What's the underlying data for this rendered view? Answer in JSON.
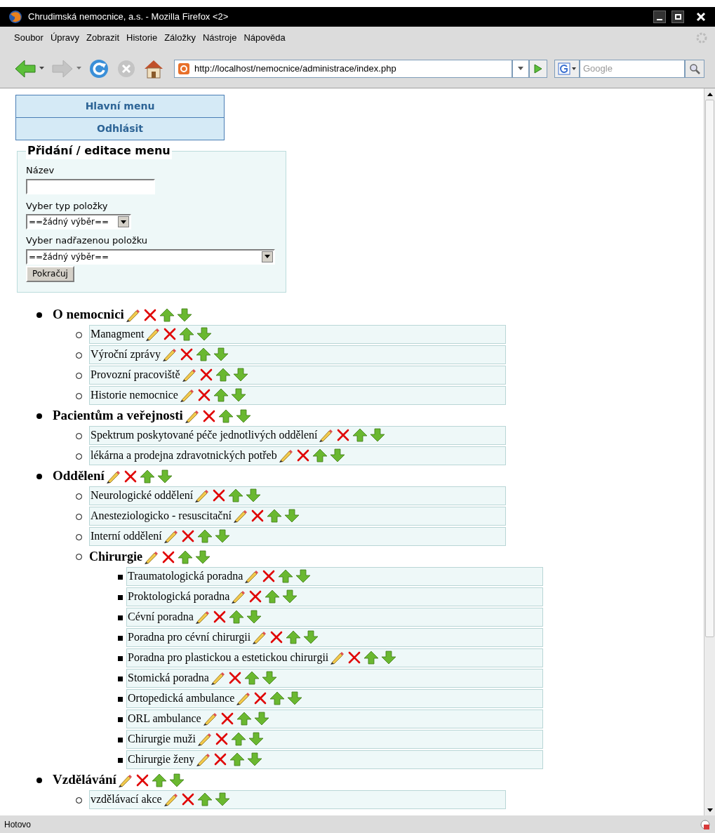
{
  "window": {
    "title": "Chrudimská nemocnice, a.s. - Mozilla Firefox <2>"
  },
  "menu_bar": [
    "Soubor",
    "Úpravy",
    "Zobrazit",
    "Historie",
    "Záložky",
    "Nástroje",
    "Nápověda"
  ],
  "nav_buttons": [
    {
      "kind": "back",
      "disabled": false
    },
    {
      "kind": "forward",
      "disabled": true
    },
    {
      "kind": "reload",
      "disabled": false
    },
    {
      "kind": "stop",
      "disabled": true
    },
    {
      "kind": "home",
      "disabled": false
    }
  ],
  "address_bar": {
    "value": "http://localhost/nemocnice/administrace/index.php"
  },
  "search_bar": {
    "placeholder": "Google"
  },
  "page": {
    "nav_links": [
      "Hlavní menu",
      "Odhlásit"
    ],
    "form": {
      "legend": "Přidání / editace menu",
      "name_label": "Název",
      "type_label": "Vyber typ položky",
      "type_value": "==žádný výběr==",
      "parent_label": "Vyber nadřazenou položku",
      "parent_value": "==žádný výběr==",
      "submit": "Pokračuj"
    },
    "tree": [
      {
        "label": "O nemocnici",
        "children": [
          {
            "label": "Managment"
          },
          {
            "label": "Výroční zprávy"
          },
          {
            "label": "Provozní pracoviště"
          },
          {
            "label": "Historie nemocnice"
          }
        ]
      },
      {
        "label": "Pacientům a veřejnosti",
        "children": [
          {
            "label": "Spektrum poskytované péče jednotlivých oddělení"
          },
          {
            "label": "lékárna a prodejna zdravotnických potřeb"
          }
        ]
      },
      {
        "label": "Oddělení",
        "children": [
          {
            "label": "Neurologické oddělení"
          },
          {
            "label": "Anesteziologicko - resuscitační"
          },
          {
            "label": "Interní oddělení"
          },
          {
            "label": "Chirurgie",
            "children": [
              {
                "label": "Traumatologická poradna"
              },
              {
                "label": "Proktologická poradna"
              },
              {
                "label": "Cévní poradna"
              },
              {
                "label": "Poradna pro cévní chirurgii"
              },
              {
                "label": "Poradna pro plastickou a estetickou chirurgii"
              },
              {
                "label": "Stomická poradna"
              },
              {
                "label": "Ortopedická ambulance"
              },
              {
                "label": "ORL ambulance"
              },
              {
                "label": "Chirurgie muži"
              },
              {
                "label": "Chirurgie ženy"
              }
            ]
          }
        ]
      },
      {
        "label": "Vzdělávání",
        "children": [
          {
            "label": "vzdělávací akce"
          }
        ]
      }
    ]
  },
  "status_bar": {
    "text": "Hotovo"
  }
}
